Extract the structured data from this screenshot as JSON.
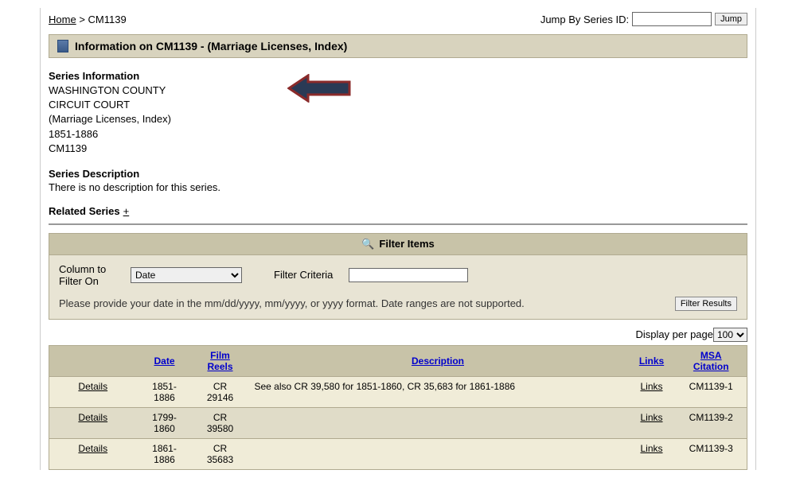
{
  "breadcrumb": {
    "home": "Home",
    "sep": ">",
    "current": "CM1139"
  },
  "jump": {
    "label": "Jump By Series ID:",
    "button": "Jump"
  },
  "info_header": "Information on CM1139 - (Marriage Licenses, Index)",
  "series_info": {
    "heading": "Series Information",
    "line1": "WASHINGTON COUNTY",
    "line2": "CIRCUIT COURT",
    "line3": "(Marriage Licenses, Index)",
    "line4": "1851-1886",
    "line5": "CM1139"
  },
  "series_desc": {
    "heading": "Series Description",
    "text": "There is no description for this series."
  },
  "related": {
    "heading": "Related Series",
    "plus": "+"
  },
  "filter": {
    "header": "Filter Items",
    "col_label": "Column to Filter On",
    "col_value": "Date",
    "criteria_label": "Filter Criteria",
    "hint": "Please provide your date in the mm/dd/yyyy, mm/yyyy, or yyyy format. Date ranges are not supported.",
    "button": "Filter Results"
  },
  "display_per": {
    "label": "Display per page",
    "value": "100"
  },
  "table": {
    "headers": {
      "date": "Date",
      "reels": "Film Reels",
      "desc": "Description",
      "links": "Links",
      "cit": "MSA Citation"
    },
    "rows": [
      {
        "details": "Details",
        "date": "1851-1886",
        "reel": "CR 29146",
        "desc": "See also CR 39,580 for 1851-1860, CR 35,683 for 1861-1886",
        "links": "Links",
        "cit": "CM1139-1"
      },
      {
        "details": "Details",
        "date": "1799-1860",
        "reel": "CR 39580",
        "desc": "",
        "links": "Links",
        "cit": "CM1139-2"
      },
      {
        "details": "Details",
        "date": "1861-1886",
        "reel": "CR 35683",
        "desc": "",
        "links": "Links",
        "cit": "CM1139-3"
      }
    ]
  }
}
